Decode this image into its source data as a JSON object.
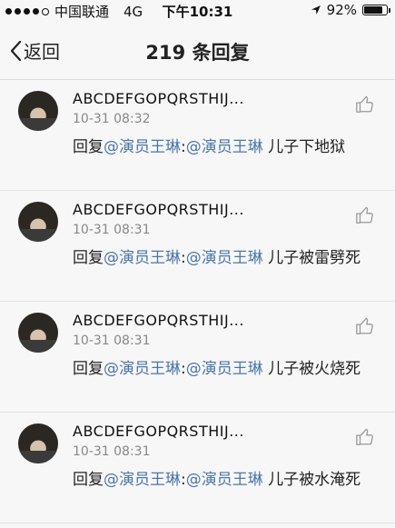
{
  "status_bar": {
    "carrier": "中国联通",
    "network": "4G",
    "time": "下午10:31",
    "battery_percent": "92%",
    "battery_level": 0.92
  },
  "nav": {
    "back_label": "返回",
    "title": "219 条回复"
  },
  "replies": [
    {
      "name": "ABCDEFGOPQRSTHIJ...",
      "time": "10-31 08:32",
      "prefix": "回复",
      "mention1": "@演员王琳",
      "sep": ":",
      "mention2": "@演员王琳",
      "body": " 儿子下地狱"
    },
    {
      "name": "ABCDEFGOPQRSTHIJ...",
      "time": "10-31 08:31",
      "prefix": "回复",
      "mention1": "@演员王琳",
      "sep": ":",
      "mention2": "@演员王琳",
      "body": " 儿子被雷劈死"
    },
    {
      "name": "ABCDEFGOPQRSTHIJ...",
      "time": "10-31 08:31",
      "prefix": "回复",
      "mention1": "@演员王琳",
      "sep": ":",
      "mention2": "@演员王琳",
      "body": " 儿子被火烧死"
    },
    {
      "name": "ABCDEFGOPQRSTHIJ...",
      "time": "10-31 08:31",
      "prefix": "回复",
      "mention1": "@演员王琳",
      "sep": ":",
      "mention2": "@演员王琳",
      "body": " 儿子被水淹死"
    }
  ]
}
